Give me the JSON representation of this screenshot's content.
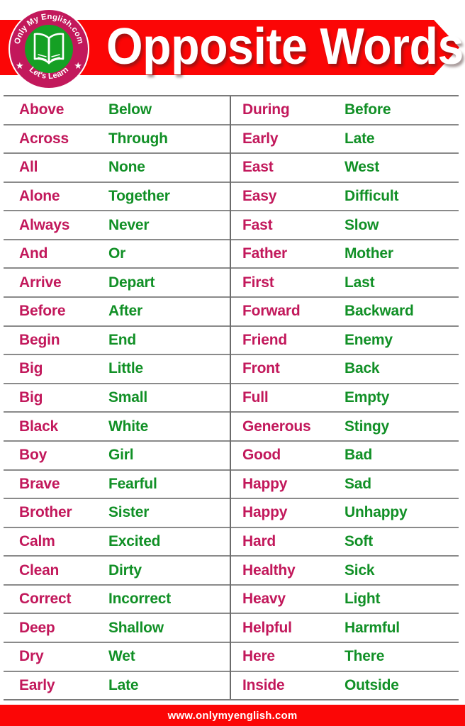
{
  "header": {
    "title": "Opposite Words",
    "banner_color": "#FB0606",
    "title_color": "#FFFFFF",
    "logo": {
      "top_arc_text": "Only My English.com",
      "bottom_arc_text": "Let's Learn",
      "icon": "open-book-icon",
      "ring_color": "#C2185B",
      "inner_color": "#15A024",
      "star_glyph": "★"
    }
  },
  "table": {
    "word_color": "#C2185B",
    "opposite_color": "#119026",
    "left_column": [
      {
        "word": "Above",
        "opposite": "Below"
      },
      {
        "word": "Across",
        "opposite": "Through"
      },
      {
        "word": "All",
        "opposite": "None"
      },
      {
        "word": "Alone",
        "opposite": "Together"
      },
      {
        "word": "Always",
        "opposite": "Never"
      },
      {
        "word": "And",
        "opposite": "Or"
      },
      {
        "word": "Arrive",
        "opposite": "Depart"
      },
      {
        "word": "Before",
        "opposite": "After"
      },
      {
        "word": "Begin",
        "opposite": "End"
      },
      {
        "word": "Big",
        "opposite": "Little"
      },
      {
        "word": "Big",
        "opposite": "Small"
      },
      {
        "word": "Black",
        "opposite": "White"
      },
      {
        "word": "Boy",
        "opposite": "Girl"
      },
      {
        "word": "Brave",
        "opposite": "Fearful"
      },
      {
        "word": "Brother",
        "opposite": "Sister"
      },
      {
        "word": "Calm",
        "opposite": "Excited"
      },
      {
        "word": "Clean",
        "opposite": "Dirty"
      },
      {
        "word": "Correct",
        "opposite": "Incorrect"
      },
      {
        "word": "Deep",
        "opposite": "Shallow"
      },
      {
        "word": "Dry",
        "opposite": "Wet"
      },
      {
        "word": "Early",
        "opposite": "Late"
      }
    ],
    "right_column": [
      {
        "word": "During",
        "opposite": "Before"
      },
      {
        "word": "Early",
        "opposite": "Late"
      },
      {
        "word": "East",
        "opposite": "West"
      },
      {
        "word": "Easy",
        "opposite": "Difficult"
      },
      {
        "word": "Fast",
        "opposite": "Slow"
      },
      {
        "word": "Father",
        "opposite": "Mother"
      },
      {
        "word": "First",
        "opposite": "Last"
      },
      {
        "word": "Forward",
        "opposite": "Backward"
      },
      {
        "word": "Friend",
        "opposite": "Enemy"
      },
      {
        "word": "Front",
        "opposite": "Back"
      },
      {
        "word": "Full",
        "opposite": "Empty"
      },
      {
        "word": "Generous",
        "opposite": "Stingy"
      },
      {
        "word": "Good",
        "opposite": "Bad"
      },
      {
        "word": "Happy",
        "opposite": "Sad"
      },
      {
        "word": "Happy",
        "opposite": "Unhappy"
      },
      {
        "word": "Hard",
        "opposite": "Soft"
      },
      {
        "word": "Healthy",
        "opposite": "Sick"
      },
      {
        "word": "Heavy",
        "opposite": "Light"
      },
      {
        "word": "Helpful",
        "opposite": "Harmful"
      },
      {
        "word": "Here",
        "opposite": "There"
      },
      {
        "word": "Inside",
        "opposite": "Outside"
      }
    ]
  },
  "footer": {
    "url": "www.onlymyenglish.com",
    "background_color": "#FB0606",
    "text_color": "#FFFFFF"
  }
}
